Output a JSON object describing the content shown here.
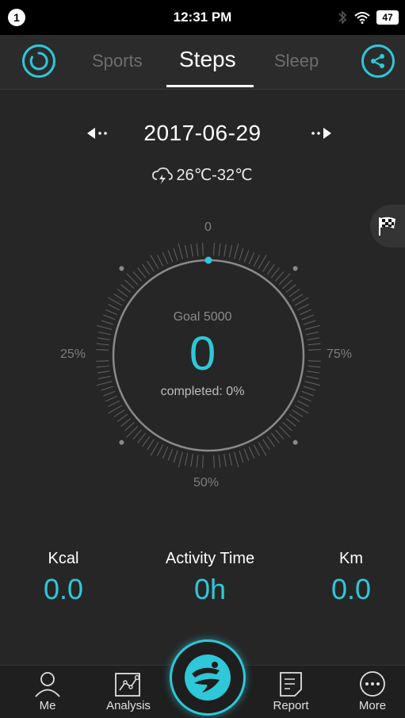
{
  "status_bar": {
    "notification_count": "1",
    "time": "12:31 PM",
    "battery": "47"
  },
  "header": {
    "tabs": [
      {
        "label": "Sports",
        "selected": false
      },
      {
        "label": "Steps",
        "selected": true
      },
      {
        "label": "Sleep",
        "selected": false
      }
    ]
  },
  "date_nav": {
    "date": "2017-06-29",
    "weather": "26℃-32℃"
  },
  "dial": {
    "label_top": "0",
    "label_left": "25%",
    "label_right": "75%",
    "label_bottom": "50%",
    "goal": "Goal 5000",
    "steps": "0",
    "completed": "completed: 0%",
    "progress_fraction": 0
  },
  "stats": {
    "kcal_label": "Kcal",
    "kcal_value": "0.0",
    "activity_label": "Activity Time",
    "activity_value": "0h",
    "km_label": "Km",
    "km_value": "0.0"
  },
  "bottom_nav": {
    "me": "Me",
    "analysis": "Analysis",
    "report": "Report",
    "more": "More"
  },
  "colors": {
    "accent": "#2ec8d8",
    "background": "#262626"
  }
}
